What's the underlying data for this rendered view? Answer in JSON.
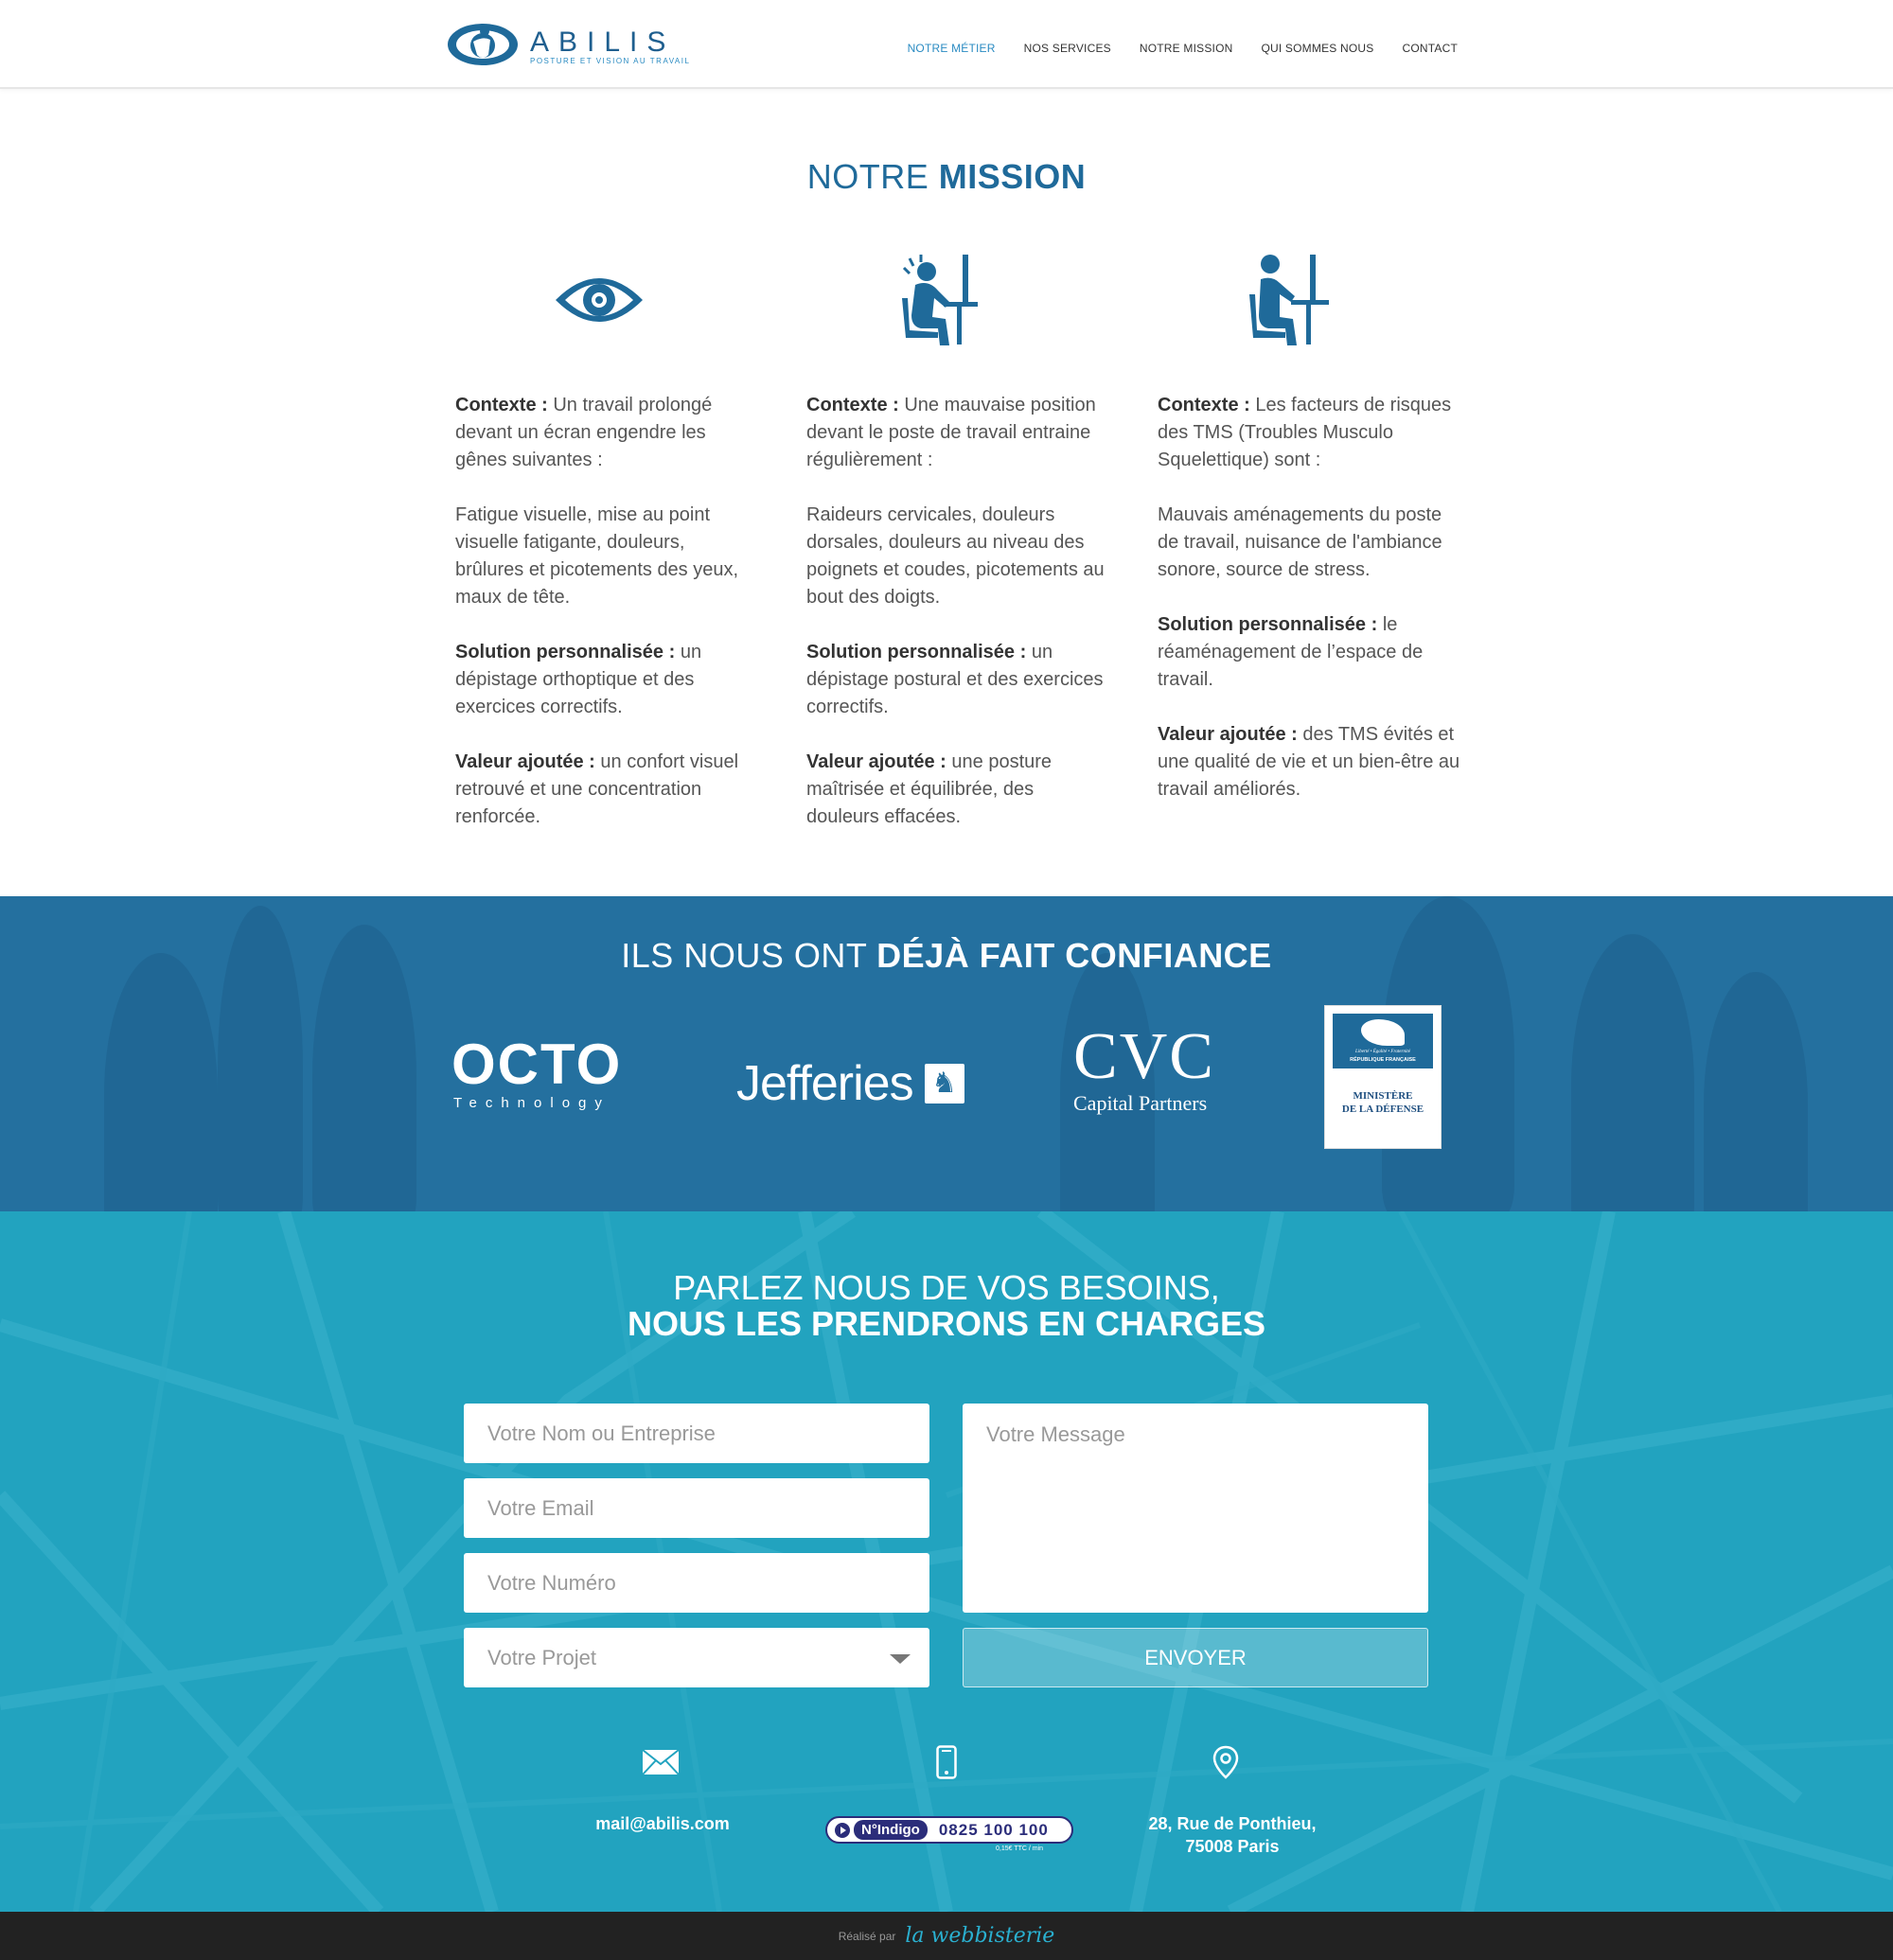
{
  "header": {
    "logo_text": "ABILIS",
    "logo_tagline": "POSTURE ET VISION AU TRAVAIL",
    "nav": [
      "NOTRE MÉTIER",
      "NOS SERVICES",
      "NOTRE MISSION",
      "QUI SOMMES NOUS",
      "CONTACT"
    ],
    "accent_color": "#2a8bc2"
  },
  "mission": {
    "title_light": "NOTRE ",
    "title_bold": "MISSION",
    "columns": [
      {
        "icon": "eye-icon",
        "contexte_label": "Contexte :",
        "contexte_text": " Un travail prolongé devant un écran engendre les gênes suivantes :",
        "symptoms": "Fatigue visuelle, mise au point visuelle fatigante, douleurs, brûlures et picotements des yeux, maux de tête.",
        "solution_label": "Solution personnalisée :",
        "solution_text": " un dépistage orthoptique et des exercices correctifs.",
        "valeur_label": "Valeur ajoutée :",
        "valeur_text": " un confort visuel retrouvé  et une concentration renforcée."
      },
      {
        "icon": "worker-pain-icon",
        "contexte_label": "Contexte :",
        "contexte_text": " Une mauvaise position devant le poste de travail entraine régulièrement :",
        "symptoms": "Raideurs cervicales, douleurs dorsales, douleurs au niveau des poignets et coudes, picotements au bout des doigts.",
        "solution_label": "Solution personnalisée :",
        "solution_text": " un dépistage postural et des exercices correctifs.",
        "valeur_label": "Valeur ajoutée :",
        "valeur_text": " une posture maîtrisée et équilibrée, des douleurs effacées."
      },
      {
        "icon": "worker-desk-icon",
        "contexte_label": "Contexte :",
        "contexte_text": " Les facteurs de risques des TMS (Troubles Musculo Squelettique) sont :",
        "symptoms": "Mauvais aménagements du poste de travail, nuisance de l'ambiance sonore, source de stress.",
        "solution_label": "Solution personnalisée :",
        "solution_text": " le réaménagement de l’espace de travail.",
        "valeur_label": "Valeur ajoutée :",
        "valeur_text": " des TMS évités et une qualité de vie et un bien-être au travail améliorés."
      }
    ]
  },
  "clients": {
    "title_light": "ILS NOUS ONT ",
    "title_bold": "DÉJÀ FAIT CONFIANCE",
    "octo": "OCTO",
    "octo_sub": "Technology",
    "jefferies": "Jefferies",
    "cvc": "CVC",
    "cvc_sub": "Capital Partners",
    "defense_motto": "Liberté • Égalité • Fraternité",
    "defense_rf": "RÉPUBLIQUE FRANÇAISE",
    "defense_line1": "MINISTÈRE",
    "defense_line2": "DE LA DÉFENSE"
  },
  "contact": {
    "title_line1": "PARLEZ NOUS DE VOS BESOINS,",
    "title_line2": "NOUS LES PRENDRONS EN CHARGES",
    "name_placeholder": "Votre Nom ou Entreprise",
    "email_placeholder": "Votre Email",
    "phone_placeholder": "Votre Numéro",
    "project_placeholder": "Votre Projet",
    "message_placeholder": "Votre Message",
    "send_label": "ENVOYER",
    "email": "mail@abilis.com",
    "indigo_label": "N°Indigo",
    "indigo_number": "0825 100 100",
    "indigo_price": "0,15€ TTC / min",
    "address_line1": "28, Rue de Ponthieu,",
    "address_line2": "75008 Paris"
  },
  "footer": {
    "made_by": "Réalisé par",
    "brand": "la webbisterie"
  }
}
